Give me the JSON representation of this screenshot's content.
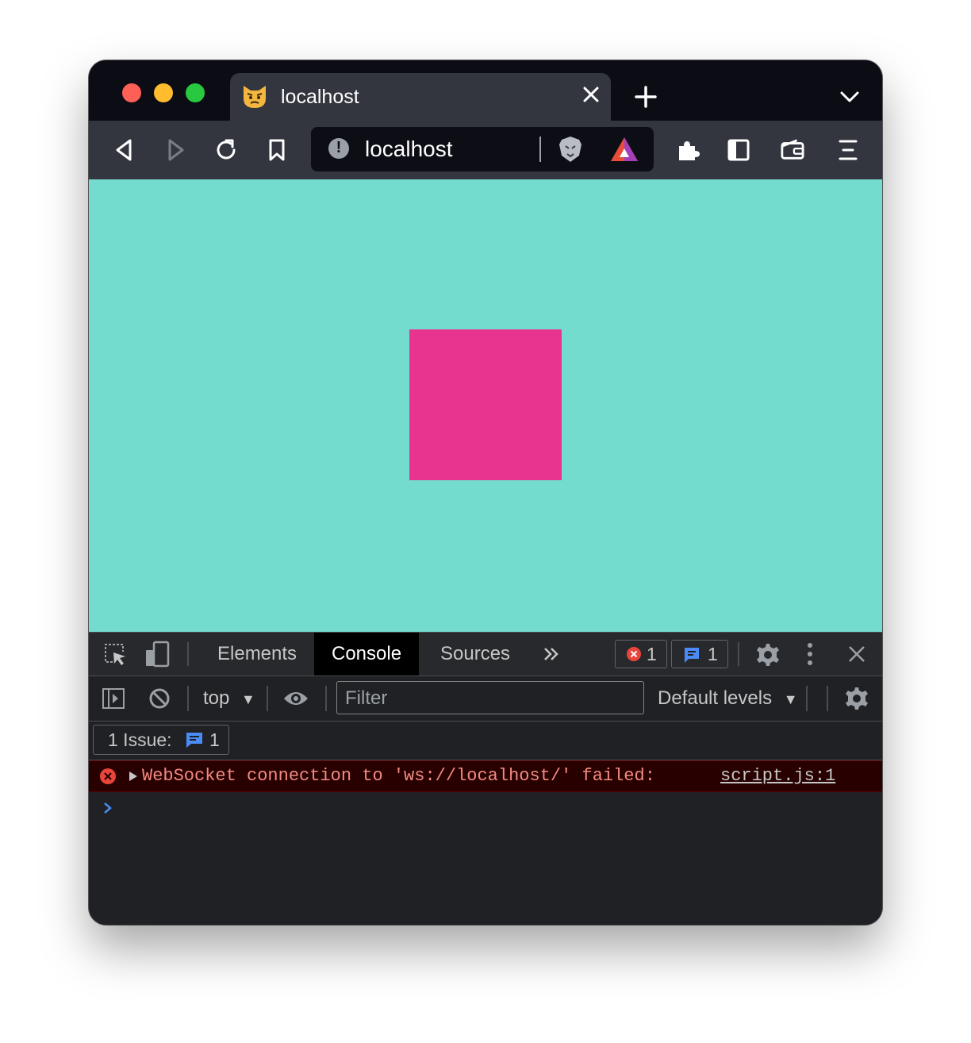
{
  "browser": {
    "tab": {
      "title": "localhost"
    },
    "address_bar": {
      "url": "localhost"
    }
  },
  "page": {
    "background_color": "#74dccf",
    "square_color": "#e8348f"
  },
  "devtools": {
    "tabs": [
      {
        "label": "Elements",
        "active": false
      },
      {
        "label": "Console",
        "active": true
      },
      {
        "label": "Sources",
        "active": false
      }
    ],
    "error_count": "1",
    "issue_count": "1",
    "console_toolbar": {
      "context": "top",
      "filter_placeholder": "Filter",
      "levels": "Default levels"
    },
    "issues_bar": {
      "label": "1 Issue:",
      "count": "1"
    },
    "messages": [
      {
        "level": "error",
        "text": "WebSocket connection to 'ws://localhost/' failed:",
        "source": "script.js:1"
      }
    ]
  }
}
